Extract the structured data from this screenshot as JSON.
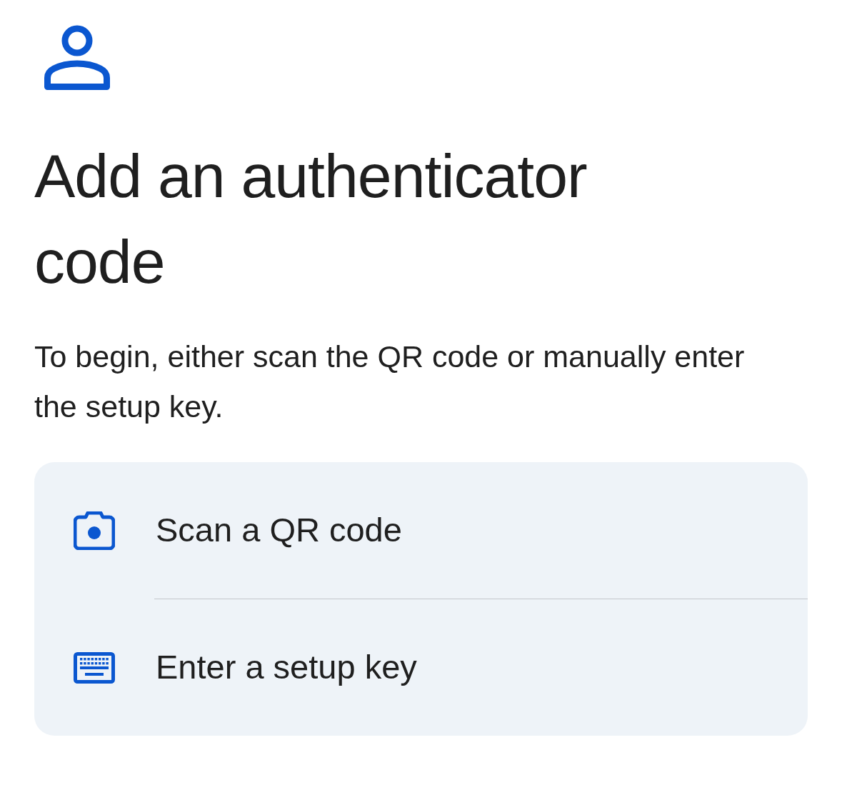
{
  "title": "Add an authenticator code",
  "description": "To begin, either scan the QR code or manually enter the setup key.",
  "options": [
    {
      "kind": "camera",
      "label": "Scan a QR code"
    },
    {
      "kind": "keyboard",
      "label": "Enter a setup key"
    }
  ]
}
